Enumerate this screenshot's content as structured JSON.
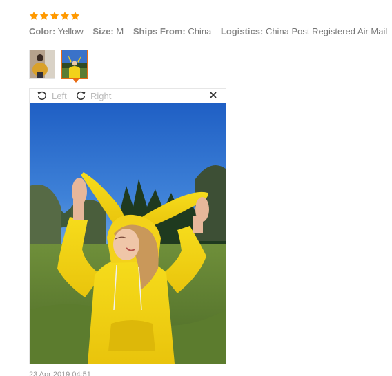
{
  "review": {
    "rating": 5,
    "stars": [
      "star-1",
      "star-2",
      "star-3",
      "star-4",
      "star-5"
    ],
    "star_color": "#ff9900",
    "attributes": [
      {
        "label": "Color:",
        "value": "Yellow"
      },
      {
        "label": "Size:",
        "value": "M"
      },
      {
        "label": "Ships From:",
        "value": "China"
      },
      {
        "label": "Logistics:",
        "value": "China Post Registered Air Mail"
      }
    ],
    "date": "23 Apr 2019 04:51"
  },
  "viewer": {
    "left_label": "Left",
    "right_label": "Right",
    "accent_color": "#e86b12"
  }
}
